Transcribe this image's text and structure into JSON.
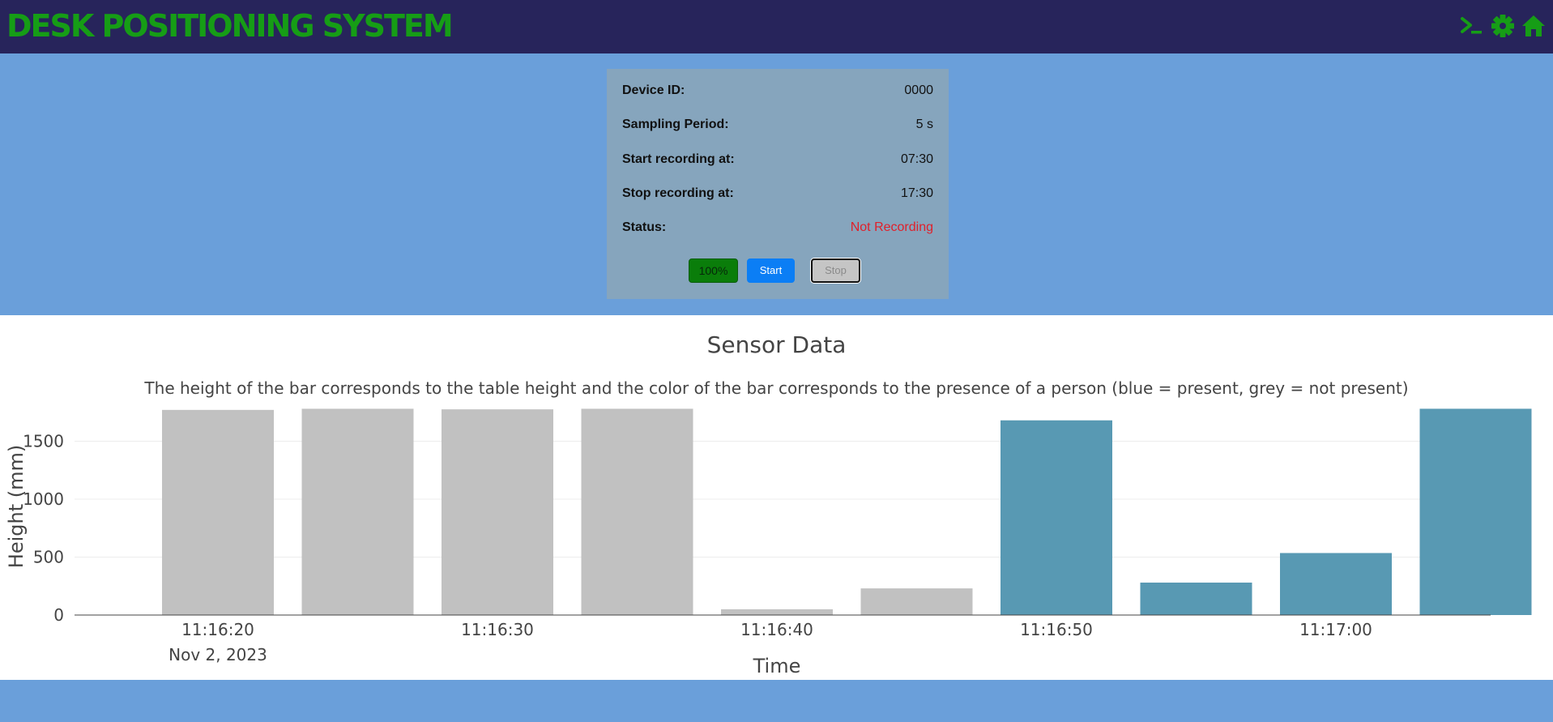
{
  "header": {
    "title": "DESK POSITIONING SYSTEM",
    "icons": [
      "terminal-icon",
      "gear-icon",
      "home-icon"
    ],
    "accent_color": "#169d16",
    "background_color": "#27245b"
  },
  "panel": {
    "rows": [
      {
        "label": "Device ID:",
        "value": "0000"
      },
      {
        "label": "Sampling Period:",
        "value": "5 s"
      },
      {
        "label": "Start recording at:",
        "value": "07:30"
      },
      {
        "label": "Stop recording at:",
        "value": "17:30"
      },
      {
        "label": "Status:",
        "value": "Not Recording"
      }
    ],
    "battery_label": "100%",
    "start_label": "Start",
    "stop_label": "Stop",
    "status_color": "#e0202a"
  },
  "chart_data": {
    "type": "bar",
    "title": "Sensor Data",
    "subtitle": "The height of the bar corresponds to the table height and the color of the bar corresponds to the presence of a person (blue = present, grey = not present)",
    "xlabel": "Time",
    "ylabel": "Height (mm)",
    "x_tick_labels": [
      "11:16:20",
      "11:16:30",
      "11:16:40",
      "11:16:50",
      "11:17:00"
    ],
    "x_date_label": "Nov 2, 2023",
    "y_ticks": [
      0,
      500,
      1000,
      1500
    ],
    "ylim": [
      0,
      1790
    ],
    "grid": true,
    "colors": {
      "present": "#5899b3",
      "not_present": "#c1c1c1"
    },
    "points": [
      {
        "time": "11:16:20",
        "height": 1770,
        "present": false
      },
      {
        "time": "11:16:25",
        "height": 1780,
        "present": false
      },
      {
        "time": "11:16:30",
        "height": 1775,
        "present": false
      },
      {
        "time": "11:16:35",
        "height": 1780,
        "present": false
      },
      {
        "time": "11:16:40",
        "height": 50,
        "present": false
      },
      {
        "time": "11:16:45",
        "height": 230,
        "present": false
      },
      {
        "time": "11:16:50",
        "height": 1680,
        "present": true
      },
      {
        "time": "11:16:55",
        "height": 280,
        "present": true
      },
      {
        "time": "11:17:00",
        "height": 535,
        "present": true
      },
      {
        "time": "11:17:05",
        "height": 1780,
        "present": true
      }
    ]
  }
}
